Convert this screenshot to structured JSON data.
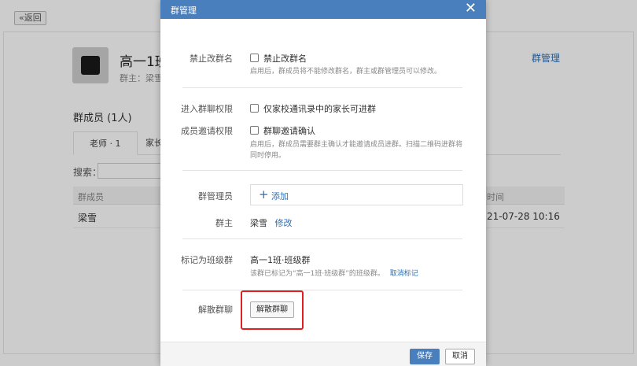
{
  "background": {
    "back_label": "返回",
    "group_name": "高一1班",
    "owner_text": "群主：梁雪",
    "manage_link": "群管理",
    "members_title": "群成员 (1人)",
    "tabs": [
      {
        "label": "老师 · 1"
      },
      {
        "label": "家长"
      }
    ],
    "search_label": "搜索：",
    "table": {
      "headers": [
        "群成员",
        "时间"
      ],
      "rows": [
        {
          "name": "梁雪",
          "time": "21-07-28 10:16"
        }
      ]
    }
  },
  "dialog": {
    "title": "群管理",
    "close_icon": "close-icon",
    "rename": {
      "label": "禁止改群名",
      "checkbox_label": "禁止改群名",
      "checked": false,
      "hint": "启用后，群成员将不能修改群名，群主或群管理员可以修改。"
    },
    "join_permission": {
      "label": "进入群聊权限",
      "checkbox_label": "仅家校通讯录中的家长可进群",
      "checked": false
    },
    "invite_permission": {
      "label": "成员邀请权限",
      "checkbox_label": "群聊邀请确认",
      "checked": false,
      "hint": "启用后，群成员需要群主确认才能邀请成员进群。扫描二维码进群将同时停用。"
    },
    "admins": {
      "label": "群管理员",
      "add_label": "添加"
    },
    "owner": {
      "label": "群主",
      "name": "梁雪",
      "edit_link": "修改"
    },
    "class_group": {
      "label": "标记为班级群",
      "value": "高一1班·班级群",
      "hint": "该群已标记为“高一1班·班级群”的班级群。",
      "cancel_link": "取消标记"
    },
    "dissolve": {
      "label": "解散群聊",
      "button_label": "解散群聊"
    },
    "footer": {
      "save_label": "保存",
      "cancel_label": "取消"
    },
    "colors": {
      "header": "#4a7fbd",
      "link": "#2c6fb6",
      "highlight": "#e02020"
    }
  }
}
